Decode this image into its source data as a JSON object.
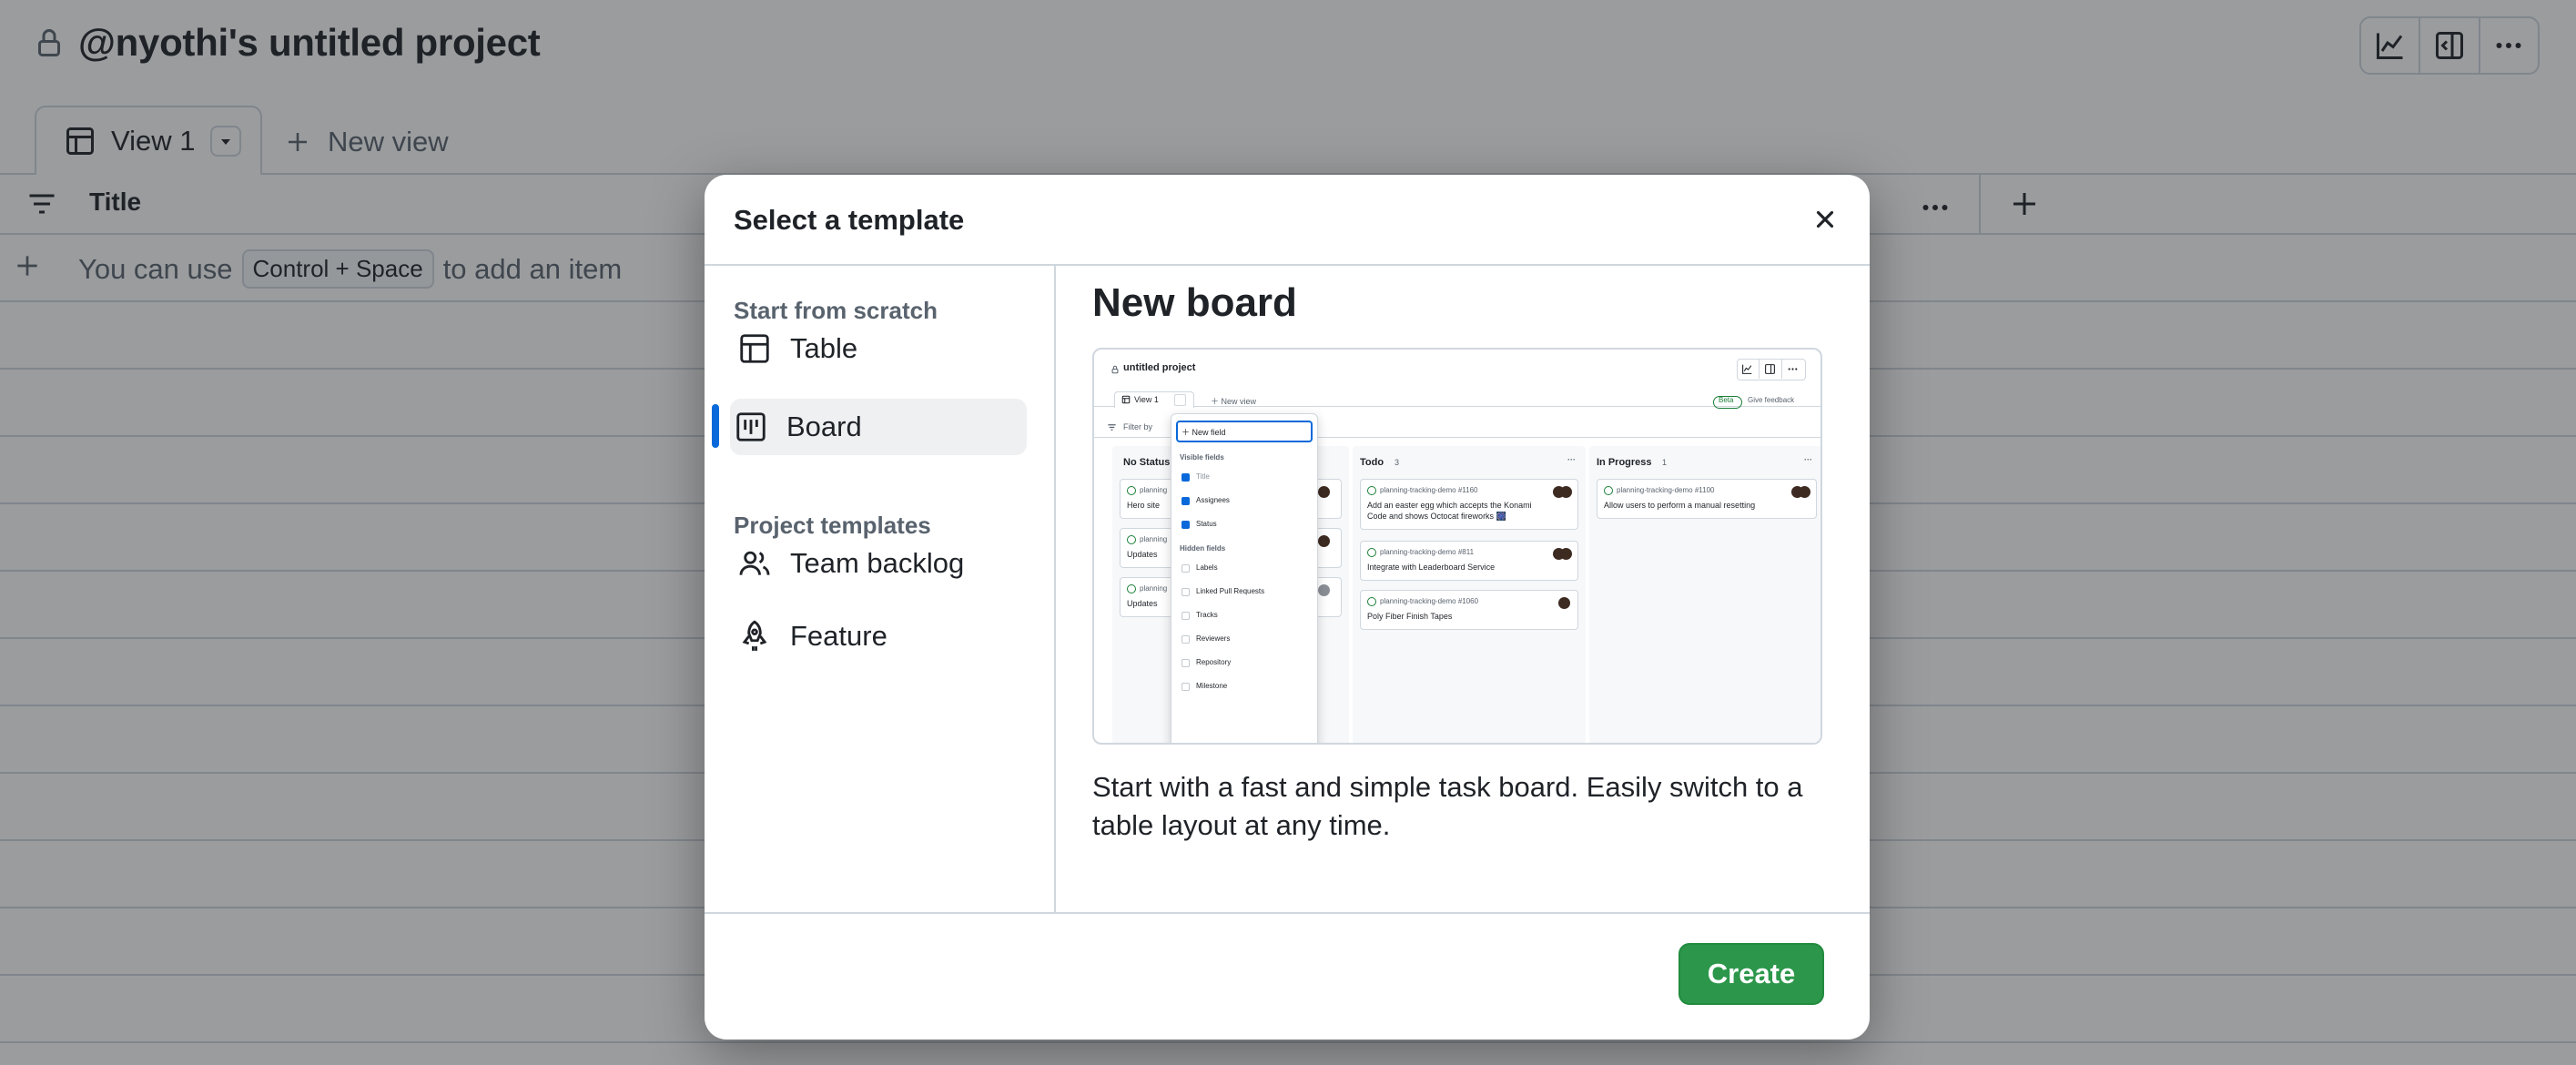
{
  "project": {
    "title": "@nyothi's untitled project"
  },
  "tabs": {
    "view1_label": "View 1",
    "new_view_label": "New view"
  },
  "table": {
    "title_column": "Title",
    "add_hint_before": "You can use",
    "add_hint_kbd": "Control + Space",
    "add_hint_after": "to add an item"
  },
  "dialog": {
    "title": "Select a template",
    "sections": {
      "scratch": "Start from scratch",
      "project_templates": "Project templates"
    },
    "nav": {
      "table": "Table",
      "board": "Board",
      "team_backlog": "Team backlog",
      "feature": "Feature"
    },
    "selected": "board",
    "preview": {
      "title": "New board",
      "description": "Start with a fast and simple task board. Easily switch to a table layout at any time."
    },
    "create_label": "Create",
    "accent": "#2c974b"
  },
  "mini": {
    "project": "untitled project",
    "view": "View 1",
    "new_view": "New view",
    "beta": "Beta",
    "feedback": "Give feedback",
    "filter": "Filter by",
    "new_field": "New field",
    "visible_fields": "Visible fields",
    "hidden_fields": "Hidden fields",
    "fields_visible": [
      "Title",
      "Assignees",
      "Status"
    ],
    "fields_hidden": [
      "Labels",
      "Linked Pull Requests",
      "Tracks",
      "Reviewers",
      "Repository",
      "Milestone"
    ],
    "columns": {
      "no_status": "No Status",
      "todo": "Todo",
      "todo_count": "3",
      "in_progress": "In Progress",
      "in_progress_count": "1"
    },
    "no_status_cards": [
      "planning",
      "Hero site",
      "planning",
      "Updates",
      "planning",
      "Updates"
    ],
    "todo_cards": [
      {
        "ref": "planning-tracking-demo #1160",
        "text1": "Add an easter egg which accepts the Konami",
        "text2": "Code and shows Octocat fireworks 🎆"
      },
      {
        "ref": "planning-tracking-demo #811",
        "text1": "Integrate with Leaderboard Service",
        "text2": ""
      },
      {
        "ref": "planning-tracking-demo #1060",
        "text1": "Poly Fiber Finish Tapes",
        "text2": ""
      }
    ],
    "inprogress_card": {
      "ref": "planning-tracking-demo #1100",
      "text1": "Allow users to perform a manual resetting"
    }
  }
}
